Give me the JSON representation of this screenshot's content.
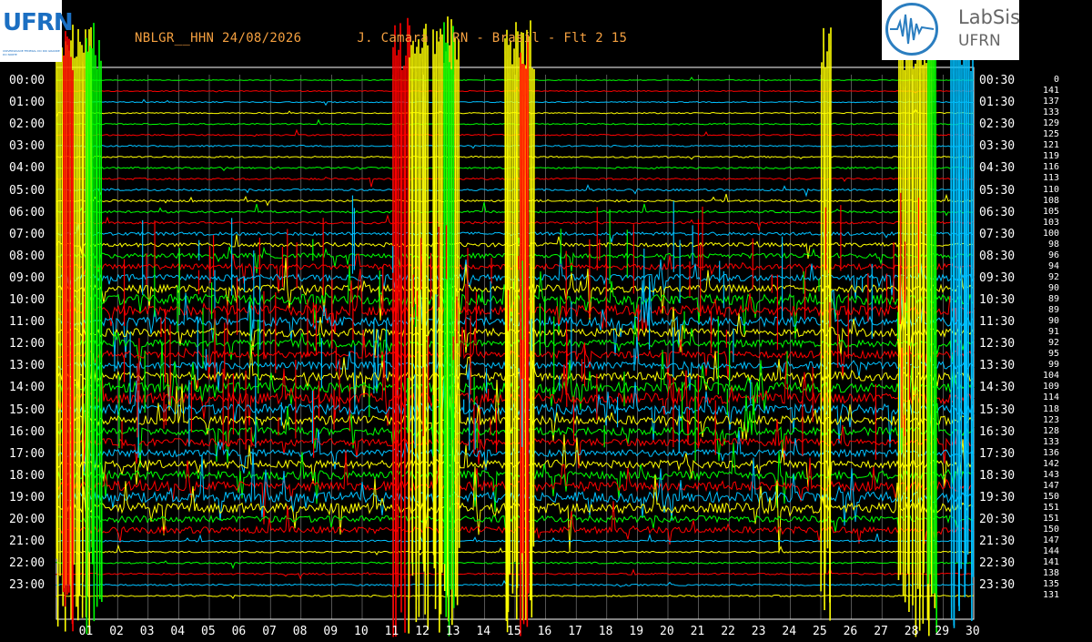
{
  "header": {
    "title": "NBLGR__HHN 24/08/2026       J. Camara - RN - Brasil - Flt 2 15"
  },
  "logos": {
    "left": {
      "text": "UFRN",
      "subtext": "UNIVERSIDADE FEDERAL DO RIO GRANDE DO NORTE"
    },
    "right": {
      "line1": "LabSis",
      "line2": "UFRN"
    }
  },
  "chart_data": {
    "type": "helicorder",
    "rows_left_labels": [
      "00:00",
      "01:00",
      "02:00",
      "03:00",
      "04:00",
      "05:00",
      "06:00",
      "07:00",
      "08:00",
      "09:00",
      "10:00",
      "11:00",
      "12:00",
      "13:00",
      "14:00",
      "15:00",
      "16:00",
      "17:00",
      "18:00",
      "19:00",
      "20:00",
      "21:00",
      "22:00",
      "23:00"
    ],
    "rows_right_labels": [
      "00:30",
      "01:30",
      "02:30",
      "03:30",
      "04:30",
      "05:30",
      "06:30",
      "07:30",
      "08:30",
      "09:30",
      "10:30",
      "11:30",
      "12:30",
      "13:30",
      "14:30",
      "15:30",
      "16:30",
      "17:30",
      "18:30",
      "19:30",
      "20:30",
      "21:30",
      "22:30",
      "23:30"
    ],
    "scale_values": [
      0,
      141,
      137,
      133,
      129,
      125,
      121,
      119,
      116,
      113,
      110,
      108,
      105,
      103,
      100,
      98,
      96,
      94,
      92,
      90,
      89,
      89,
      90,
      91,
      92,
      95,
      99,
      104,
      109,
      114,
      118,
      123,
      128,
      133,
      136,
      142,
      143,
      147,
      150,
      151,
      151,
      150,
      147,
      144,
      141,
      138,
      135,
      131
    ],
    "x_tick_labels": [
      "01",
      "02",
      "03",
      "04",
      "05",
      "06",
      "07",
      "08",
      "09",
      "10",
      "11",
      "12",
      "13",
      "14",
      "15",
      "16",
      "17",
      "18",
      "19",
      "20",
      "21",
      "22",
      "23",
      "24",
      "25",
      "26",
      "27",
      "28",
      "29",
      "30"
    ],
    "trace_colors": [
      "#00ff00",
      "#ff0000",
      "#00c0ff",
      "#ffff00"
    ],
    "grid": true
  }
}
